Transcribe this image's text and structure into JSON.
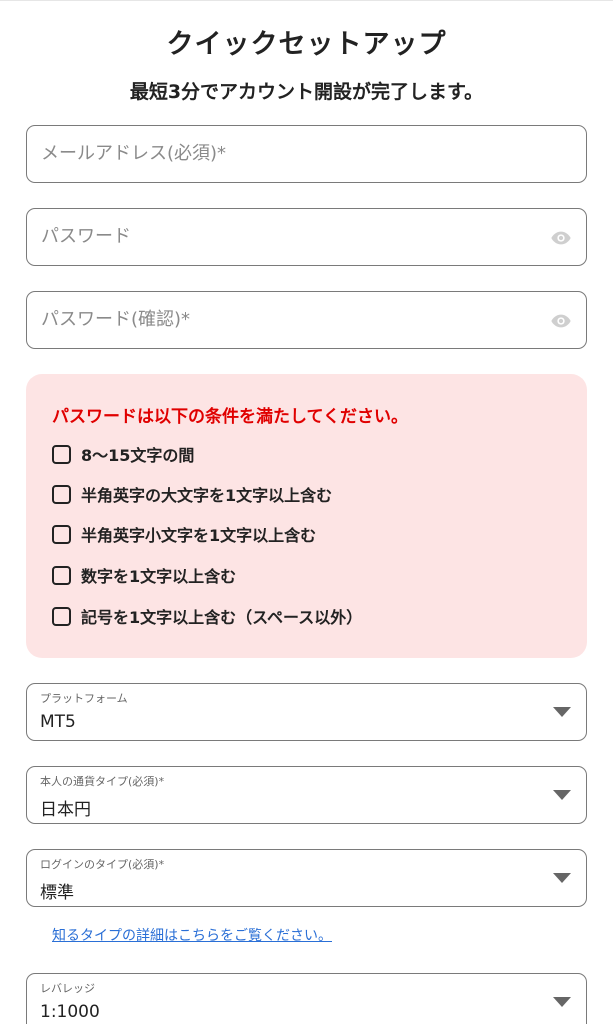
{
  "header": {
    "title": "クイックセットアップ",
    "subtitle": "最短3分でアカウント開設が完了します。"
  },
  "form": {
    "email_placeholder": "メールアドレス(必須)*",
    "password_placeholder": "パスワード",
    "password_confirm_placeholder": "パスワード(確認)*"
  },
  "requirements": {
    "title": "パスワードは以下の条件を満たしてください。",
    "items": [
      {
        "label": "8〜15文字の間",
        "checked": false
      },
      {
        "label": "半角英字の大文字を1文字以上含む",
        "checked": false
      },
      {
        "label": "半角英字小文字を1文字以上含む",
        "checked": false
      },
      {
        "label": "数字を1文字以上含む",
        "checked": false
      },
      {
        "label": "記号を1文字以上含む（スペース以外）",
        "checked": false
      }
    ]
  },
  "selects": {
    "platform": {
      "label": "プラットフォーム",
      "value": "MT5"
    },
    "currency": {
      "label": "本人の通貨タイプ(必須)*",
      "value": "日本円"
    },
    "login_type": {
      "label": "ログインのタイプ(必須)*",
      "value": "標準"
    },
    "leverage": {
      "label": "レバレッジ",
      "value": "1:1000"
    }
  },
  "links": {
    "type_details": "知るタイプの詳細はこちらをご覧ください。"
  },
  "colors": {
    "warning_bg": "#fde4e4",
    "warning_text": "#e00000",
    "link": "#2a6fd6"
  }
}
